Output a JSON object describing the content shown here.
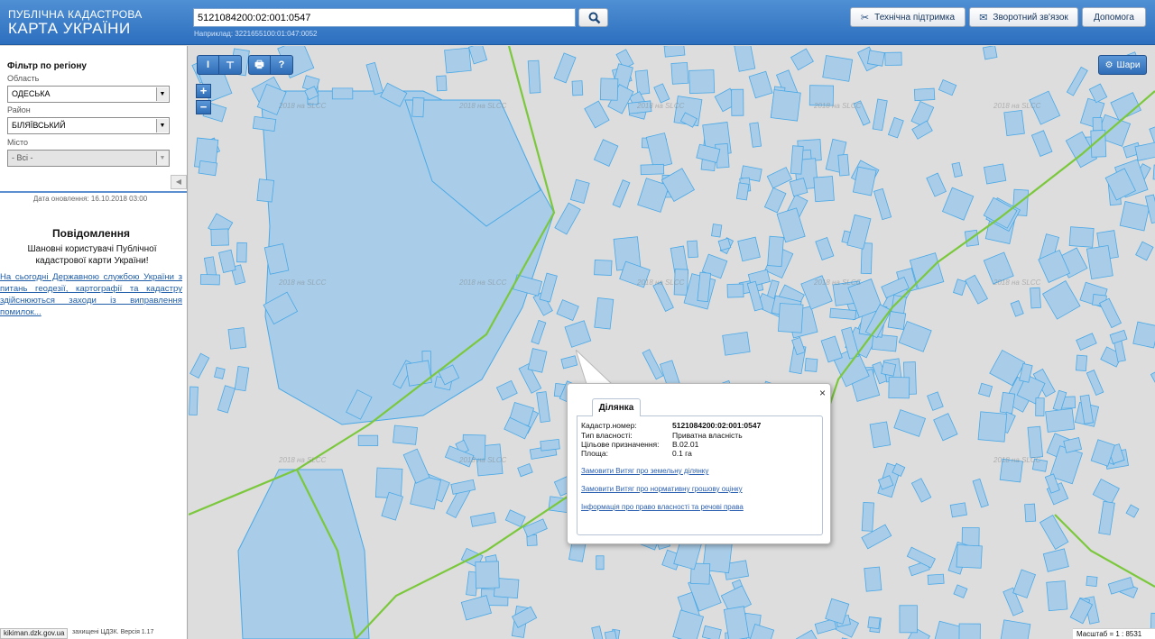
{
  "header": {
    "logo_line1": "ПУБЛІЧНА КАДАСТРОВА",
    "logo_line2": "КАРТА УКРАЇНИ",
    "search_value": "5121084200:02:001:0547",
    "search_hint": "Наприклад: 3221655100:01:047:0052",
    "buttons": {
      "support": "Технічна підтримка",
      "feedback": "Зворотний зв'язок",
      "help": "Допомога"
    }
  },
  "sidebar": {
    "filter_title": "Фільтр по регіону",
    "oblast_label": "Область",
    "oblast_value": "ОДЕСЬКА",
    "rayon_label": "Район",
    "rayon_value": "БІЛЯЇВСЬКИЙ",
    "misto_label": "Місто",
    "misto_value": "- Всі -",
    "update_date": "Дата оновлення: 16.10.2018 03:00",
    "message_title": "Повідомлення",
    "message_body": "Шановні користувачі Публічної кадастрової карти України!",
    "message_link": "На сьогодні Державною службою України з питань геодезії, картографії та кадастру здійснюються заходи із виправлення помилок...",
    "status_url": "kikiman.dzk.gov.ua",
    "version_text": "захищені ЦДЗК. Версія 1.17"
  },
  "map": {
    "tools": {
      "measure_length": "I",
      "measure_area": "⊤",
      "print": "🖶",
      "info": "?"
    },
    "zoom_in": "+",
    "zoom_out": "−",
    "layers_label": "Шари",
    "watermark": "2018 на SLCC",
    "scale_text": "Масштаб = 1 : 8531"
  },
  "popup": {
    "tab_label": "Ділянка",
    "close": "×",
    "rows": [
      {
        "key": "Кадастр.номер:",
        "value": "5121084200:02:001:0547"
      },
      {
        "key": "Тип власності:",
        "value": "Приватна власність"
      },
      {
        "key": "Цільове призначення:",
        "value": "В.02.01"
      },
      {
        "key": "Площа:",
        "value": "0.1 га"
      }
    ],
    "links": [
      "Замовити Витяг про земельну ділянку",
      "Замовити Витяг про нормативну грошову оцінку",
      "Інформація про право власності та речові права"
    ]
  },
  "colors": {
    "header": "#2d6fbf",
    "parcel_fill": "#a9cde8",
    "parcel_stroke": "#4aa8e6",
    "boundary": "#7bc83c",
    "link": "#2a5fb0"
  }
}
